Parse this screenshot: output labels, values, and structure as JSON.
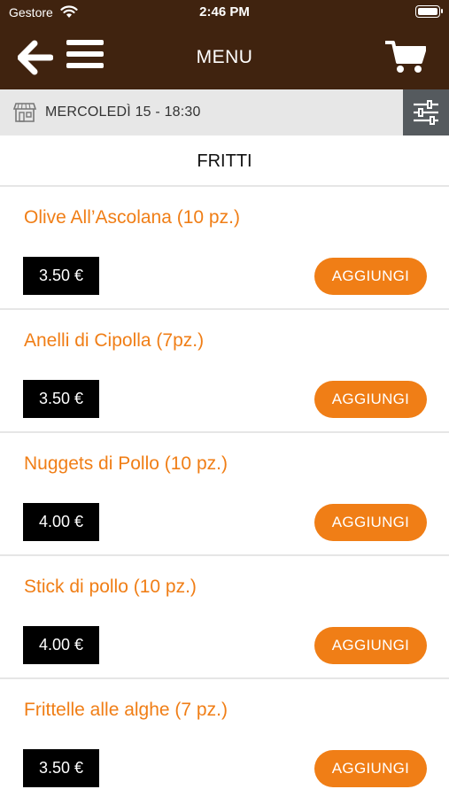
{
  "status": {
    "carrier": "Gestore",
    "time": "2:46 PM"
  },
  "header": {
    "title": "MENU",
    "back_icon": "arrow-left-icon",
    "menu_icon": "hamburger-icon",
    "cart_icon": "cart-icon"
  },
  "datebar": {
    "text": "MERCOLEDÌ 15 - 18:30",
    "icon": "store-icon",
    "filter_icon": "sliders-icon"
  },
  "category": {
    "title": "FRITTI"
  },
  "items": [
    {
      "name": "Olive All’Ascolana (10 pz.)",
      "price": "3.50 €",
      "add_label": "AGGIUNGI"
    },
    {
      "name": "Anelli di Cipolla (7pz.)",
      "price": "3.50 €",
      "add_label": "AGGIUNGI"
    },
    {
      "name": "Nuggets di Pollo (10 pz.)",
      "price": "4.00 €",
      "add_label": "AGGIUNGI"
    },
    {
      "name": "Stick di pollo (10 pz.)",
      "price": "4.00 €",
      "add_label": "AGGIUNGI"
    },
    {
      "name": "Frittelle alle alghe (7 pz.)",
      "price": "3.50 €",
      "add_label": "AGGIUNGI"
    }
  ],
  "colors": {
    "header_bg": "#40230f",
    "accent": "#f07e16",
    "datebar_bg": "#e7e7e7",
    "filter_bg": "#555a5e"
  }
}
